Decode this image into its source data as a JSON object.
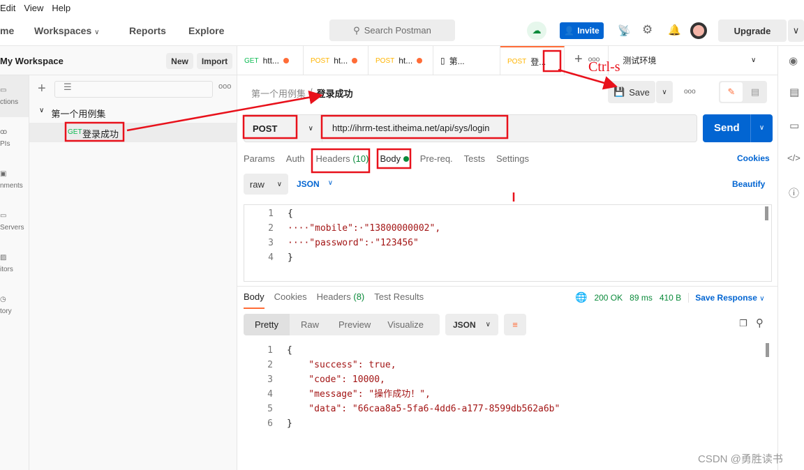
{
  "menu": [
    "Edit",
    "View",
    "Help"
  ],
  "header": {
    "nav": [
      "me",
      "Workspaces",
      "Reports",
      "Explore"
    ],
    "search_placeholder": "Search Postman",
    "invite": "Invite",
    "upgrade": "Upgrade"
  },
  "workspace": {
    "title": "My Workspace",
    "new": "New",
    "import": "Import"
  },
  "rail": [
    "ctions",
    "PIs",
    "nments",
    "Servers",
    "itors",
    "tory"
  ],
  "sidebar": {
    "collection": "第一个用例集",
    "request_method": "GET",
    "request_name": "登录成功"
  },
  "tabs": [
    {
      "method": "GET",
      "name": "htt..."
    },
    {
      "method": "POST",
      "name": "ht..."
    },
    {
      "method": "POST",
      "name": "ht..."
    },
    {
      "method": "",
      "name": "第..."
    },
    {
      "method": "POST",
      "name": "登..."
    }
  ],
  "environment": "测试环境",
  "breadcrumb": {
    "parent": "第一个用例集",
    "sep": "/",
    "current": "登录成功"
  },
  "save": "Save",
  "request": {
    "method": "POST",
    "url": "http://ihrm-test.itheima.net/api/sys/login",
    "send": "Send"
  },
  "req_tabs": {
    "params": "Params",
    "auth": "Auth",
    "headers": "Headers",
    "headers_count": "(10)",
    "body": "Body",
    "prereq": "Pre-req.",
    "tests": "Tests",
    "settings": "Settings",
    "cookies": "Cookies"
  },
  "body_opts": {
    "mode": "raw",
    "lang": "JSON",
    "beautify": "Beautify"
  },
  "req_body": [
    "{",
    "····\"mobile\":·\"13800000002\",",
    "····\"password\":·\"123456\"",
    "}"
  ],
  "resp_tabs": {
    "body": "Body",
    "cookies": "Cookies",
    "headers": "Headers",
    "headers_count": "(8)",
    "tests": "Test Results"
  },
  "resp_status": {
    "status": "200 OK",
    "time": "89 ms",
    "size": "410 B",
    "save": "Save Response"
  },
  "resp_view": [
    "Pretty",
    "Raw",
    "Preview",
    "Visualize"
  ],
  "resp_lang": "JSON",
  "resp_body": [
    "{",
    "    \"success\": true,",
    "    \"code\": 10000,",
    "    \"message\": \"操作成功！\",",
    "    \"data\": \"66caa8a5-5fa6-4dd6-a177-8599db562a6b\"",
    "}"
  ],
  "annotation": "Ctrl-s",
  "watermark": "CSDN @勇胜读书"
}
